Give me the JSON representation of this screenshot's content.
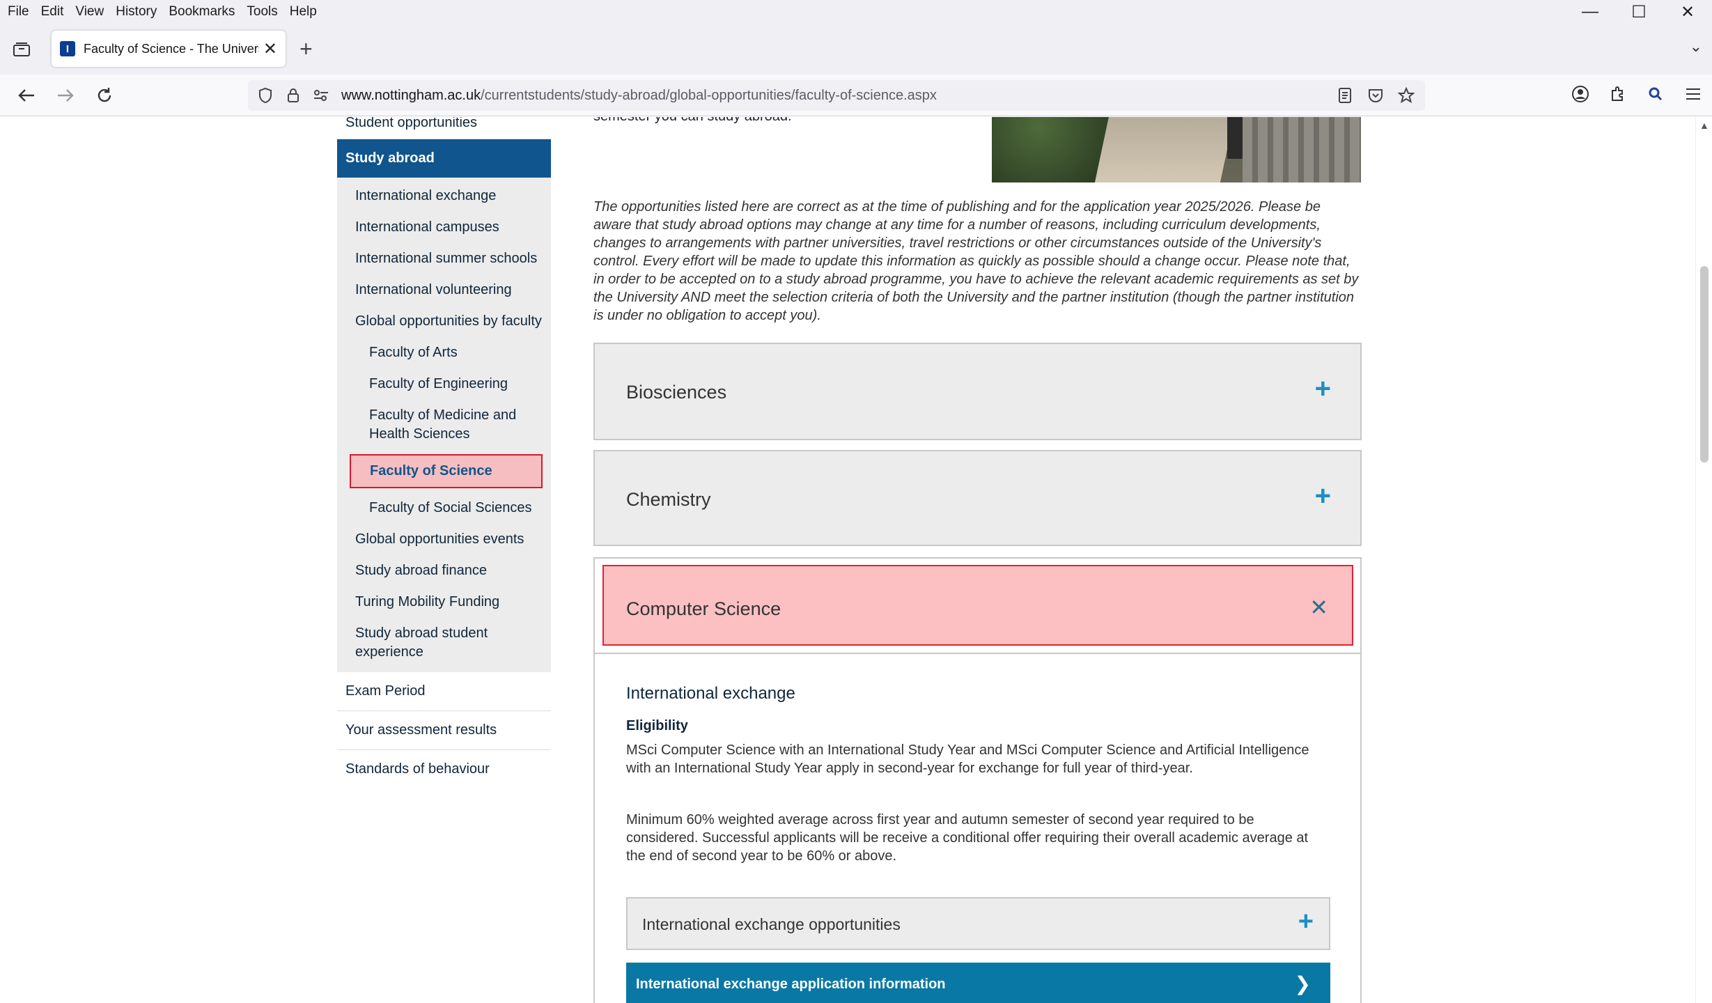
{
  "menu": [
    "File",
    "Edit",
    "View",
    "History",
    "Bookmarks",
    "Tools",
    "Help"
  ],
  "window_controls": {
    "minimize": "—",
    "maximize": "☐",
    "close": "✕"
  },
  "tab": {
    "title": "Faculty of Science - The Univers",
    "favicon_letter": "I"
  },
  "url": {
    "host": "www.nottingham.ac.uk",
    "path": "/currentstudents/study-abroad/global-opportunities/faculty-of-science.aspx"
  },
  "sidebar": {
    "top_item": "Student opportunities",
    "active_section": "Study abroad",
    "sub_items": [
      {
        "label": "International exchange"
      },
      {
        "label": "International campuses"
      },
      {
        "label": "International summer schools"
      },
      {
        "label": "International volunteering"
      },
      {
        "label": "Global opportunities by faculty"
      },
      {
        "label": "Faculty of Arts"
      },
      {
        "label": "Faculty of Engineering"
      },
      {
        "label": "Faculty of Medicine and Health Sciences"
      },
      {
        "label": "Faculty of Science"
      },
      {
        "label": "Faculty of Social Sciences"
      },
      {
        "label": "Global opportunities events"
      },
      {
        "label": "Study abroad finance"
      },
      {
        "label": "Turing Mobility Funding"
      },
      {
        "label": "Study abroad student experience"
      }
    ],
    "bottom_items": [
      "Exam Period",
      "Your assessment results",
      "Standards of behaviour"
    ]
  },
  "main": {
    "intro_tail": "semester you can study abroad.",
    "disclaimer": "The opportunities listed here are correct as at the time of publishing and for the application year 2025/2026. Please be aware that study abroad options may change at any time for a number of reasons, including curriculum developments, changes to arrangements with partner universities, travel restrictions or other circumstances outside of the University's control. Every effort will be made to update this information as quickly as possible should a change occur. Please note that, in order to be accepted on to a study abroad programme, you have to achieve the relevant academic requirements as set by the University AND meet the selection criteria of both the University and the partner institution (though the partner institution is under no obligation to accept you).",
    "accordions": [
      {
        "title": "Biosciences",
        "toggle": "+"
      },
      {
        "title": "Chemistry",
        "toggle": "+"
      }
    ],
    "open_accordion": {
      "title": "Computer Science",
      "toggle": "✕",
      "subheading": "International exchange",
      "eligibility_heading": "Eligibility",
      "paragraph1": "MSci Computer Science with an International Study Year and MSci Computer Science and Artificial Intelligence with an International Study Year apply in second-year for exchange for full year of third-year.",
      "paragraph2": "Minimum 60% weighted average across first year and autumn semester of second year required to be considered. Successful applicants will be receive a conditional offer requiring their overall academic average at the end of second year to be 60% or above.",
      "inner_accordion": {
        "title": "International exchange opportunities",
        "toggle": "+"
      },
      "cta": {
        "label": "International exchange application information",
        "arrow": "❯"
      }
    }
  },
  "colors": {
    "nav_active": "#10558d",
    "highlight_fill": "#fcc0c2",
    "highlight_border": "#e02232",
    "accent": "#1c8ec2",
    "cta": "#0a78a5"
  }
}
